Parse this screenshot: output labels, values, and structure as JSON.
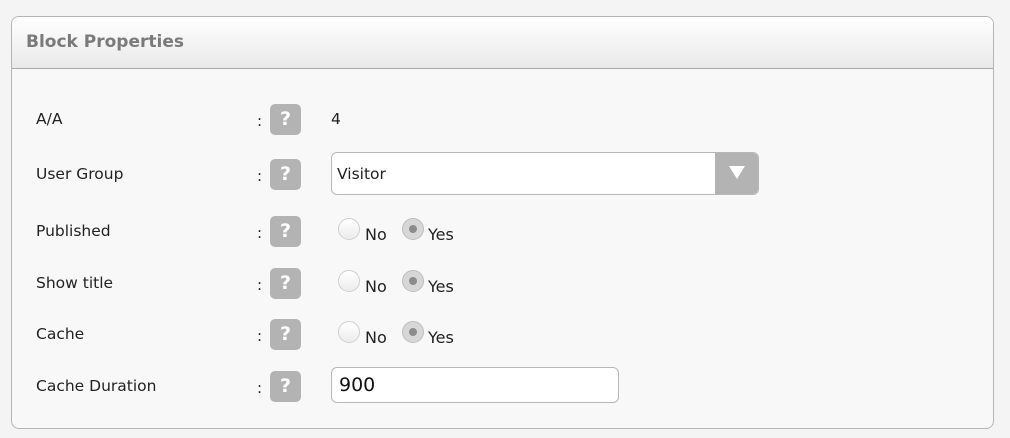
{
  "panel": {
    "title": "Block Properties"
  },
  "rows": {
    "aa": {
      "label": "A/A",
      "colon": ":",
      "help": "?",
      "value": "4"
    },
    "user_group": {
      "label": "User Group",
      "colon": ":",
      "help": "?",
      "selected": "Visitor"
    },
    "published": {
      "label": "Published",
      "colon": ":",
      "help": "?",
      "option_no": "No",
      "option_yes": "Yes",
      "selected": "Yes"
    },
    "show_title": {
      "label": "Show title",
      "colon": ":",
      "help": "?",
      "option_no": "No",
      "option_yes": "Yes",
      "selected": "Yes"
    },
    "cache": {
      "label": "Cache",
      "colon": ":",
      "help": "?",
      "option_no": "No",
      "option_yes": "Yes",
      "selected": "Yes"
    },
    "cache_duration": {
      "label": "Cache Duration",
      "colon": ":",
      "help": "?",
      "value": "900"
    }
  },
  "icons": {
    "help": "question-mark-icon",
    "dropdown": "triangle-down-icon"
  },
  "colors": {
    "help_bg": "#b3b3b3",
    "title": "#7a7a7a",
    "border": "#b5b5b5"
  }
}
